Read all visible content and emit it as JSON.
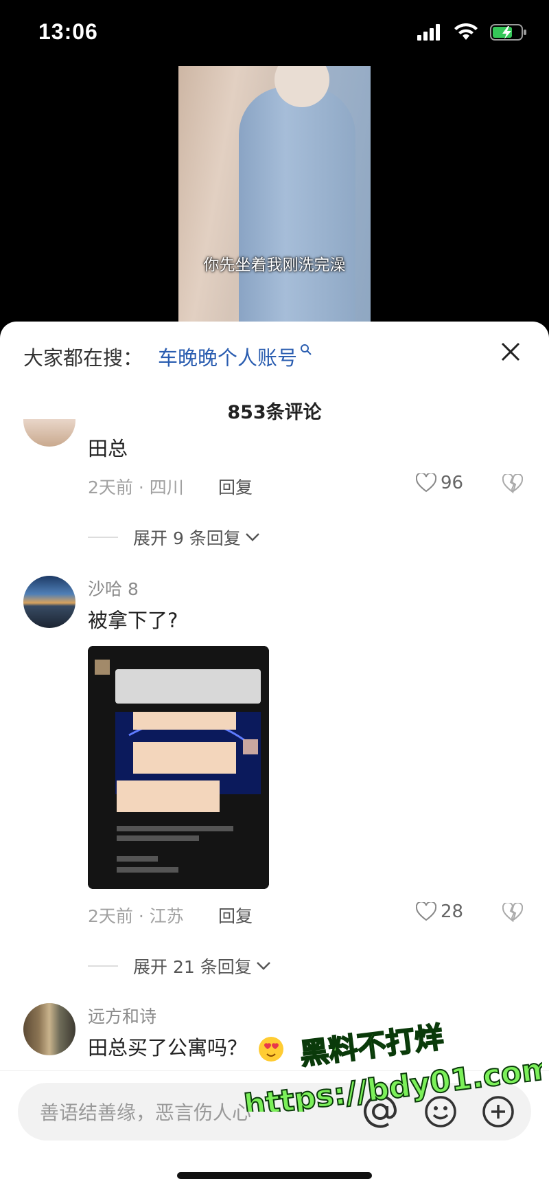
{
  "status_bar": {
    "time": "13:06",
    "icons": [
      "signal-icon",
      "wifi-icon",
      "battery-charging-icon"
    ]
  },
  "video": {
    "subtitle": "你先坐着我刚洗完澡"
  },
  "sheet": {
    "search_prefix": "大家都在搜：",
    "search_term": "车晚晚个人账号",
    "comment_count": "853条评论",
    "close_icon": "close-icon"
  },
  "comments": [
    {
      "text": "田总",
      "time_location": "2天前 · 四川",
      "reply": "回复",
      "likes": "96",
      "expand": "展开 9 条回复"
    },
    {
      "username": "沙哈 8",
      "text": "被拿下了?",
      "time_location": "2天前 · 江苏",
      "reply": "回复",
      "likes": "28",
      "expand": "展开 21 条回复"
    },
    {
      "username": "远方和诗",
      "text": "田总买了公寓吗？"
    }
  ],
  "input": {
    "placeholder": "善语结善缘，恶言伤人心"
  },
  "watermark": {
    "line1": "黑料不打烊",
    "line2": "https://bdy01.com"
  },
  "colors": {
    "accent_blue": "#2a5db0",
    "watermark_green": "#7cf05a"
  }
}
